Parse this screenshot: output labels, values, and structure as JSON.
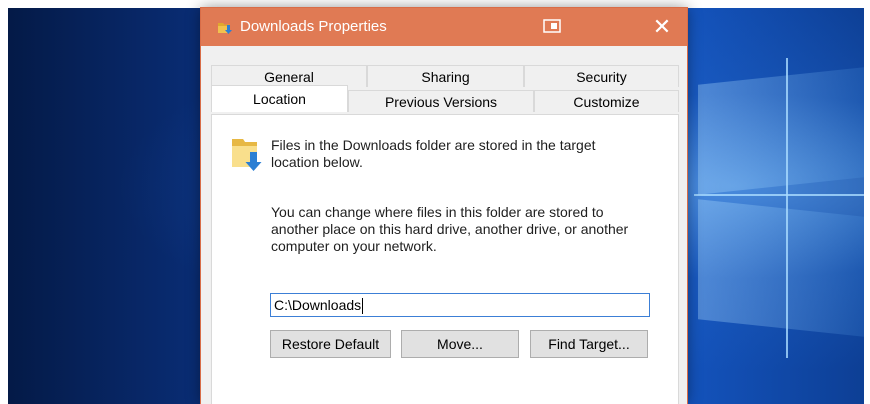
{
  "window": {
    "title": "Downloads Properties",
    "close_glyph": "✕",
    "accent_color": "#e07a54"
  },
  "tabs": {
    "row_back": [
      {
        "label": "General"
      },
      {
        "label": "Sharing"
      },
      {
        "label": "Security"
      }
    ],
    "row_front": [
      {
        "label": "Location",
        "active": true
      },
      {
        "label": "Previous Versions"
      },
      {
        "label": "Customize"
      }
    ]
  },
  "location": {
    "intro_line1": "Files in the Downloads folder are stored in the target",
    "intro_line2": "location below.",
    "desc_line1": "You can change where files in this folder are stored to",
    "desc_line2": "another place on this hard drive, another drive, or another",
    "desc_line3": "computer on your network.",
    "path_value": "C:\\Downloads"
  },
  "buttons": {
    "restore": "Restore Default",
    "move": "Move...",
    "find_target": "Find Target..."
  },
  "icons": {
    "title": "folder-download-icon",
    "mid": "window-snap-icon",
    "close": "close-icon",
    "content": "folder-download-icon"
  }
}
